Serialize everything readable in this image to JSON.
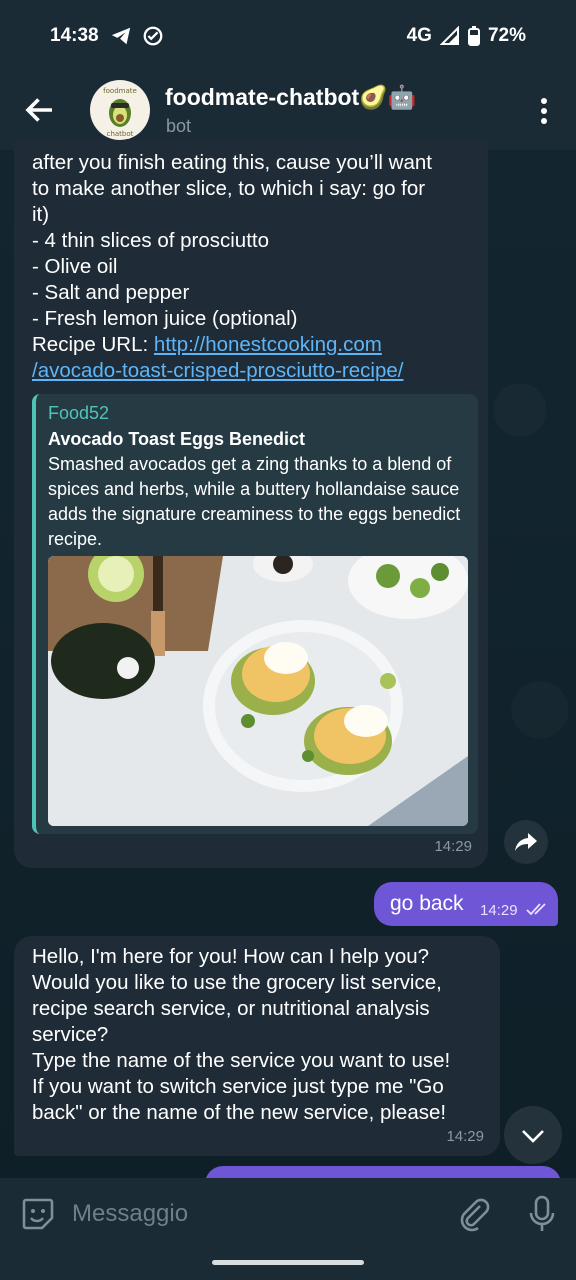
{
  "status_bar": {
    "time": "14:38",
    "network": "4G",
    "battery": "72%"
  },
  "header": {
    "title": "foodmate-chatbot🥑🤖",
    "subtitle": "bot",
    "avatar_text_top": "foodmate",
    "avatar_text_bottom": "chatbot"
  },
  "messages": [
    {
      "lines": [
        "after you finish eating this, cause you’ll want",
        "to make another slice, to which i say: go for",
        "it)",
        "- 4 thin slices of prosciutto",
        "- Olive oil",
        "- Salt and pepper",
        "- Fresh lemon juice (optional)"
      ],
      "url_label": "Recipe URL: ",
      "url_line1": "http://honestcooking.com",
      "url_line2": "/avocado-toast-crisped-prosciutto-recipe/",
      "preview": {
        "site": "Food52",
        "title": "Avocado Toast Eggs Benedict",
        "description": "Smashed avocados get a zing thanks to a blend of spices and herbs, while a buttery hollandaise sauce adds the signature creaminess to the eggs benedict recipe."
      },
      "time": "14:29"
    },
    {
      "text": "go back",
      "time": "14:29"
    },
    {
      "lines": [
        "Hello, I'm here for you! How can I help you?",
        "Would you like to use the grocery list service,",
        "recipe search service, or nutritional analysis",
        "service?",
        "Type the name of the service you want to use!",
        "If you want to switch service just type me \"Go",
        "back\" or the name of the new service, please!"
      ],
      "time": "14:29"
    }
  ],
  "input": {
    "placeholder": "Messaggio"
  },
  "colors": {
    "accent": "#6f56d6",
    "link": "#5eb5f7",
    "preview_bar": "#4fc4b6",
    "bubble_in": "#1f2c37",
    "header": "#1b2b35"
  }
}
